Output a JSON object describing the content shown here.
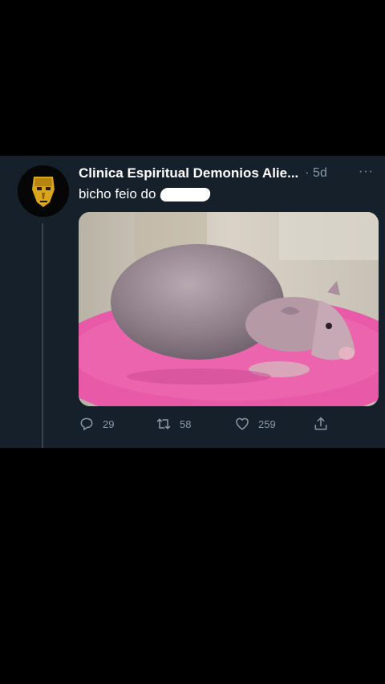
{
  "tweet": {
    "author_name": "Clinica Espiritual Demonios Alie...",
    "timestamp": "· 5d",
    "more_icon": "more-options-icon",
    "text": "bicho feio do",
    "media_description_icon": "tweet-photo",
    "actions": {
      "reply_count": "29",
      "retweet_count": "58",
      "like_count": "259"
    }
  },
  "colors": {
    "background": "#000000",
    "card": "#15202b",
    "text_primary": "#ffffff",
    "text_secondary": "#8899a6",
    "thread_line": "#38444d"
  }
}
